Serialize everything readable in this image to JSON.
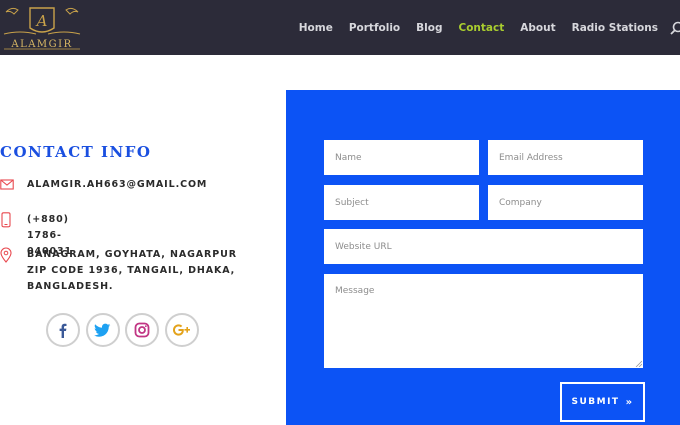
{
  "header": {
    "logo": {
      "monogram": "A",
      "wordmark": "ALAMGIR"
    },
    "nav": [
      {
        "label": "Home",
        "active": false
      },
      {
        "label": "Portfolio",
        "active": false
      },
      {
        "label": "Blog",
        "active": false
      },
      {
        "label": "Contact",
        "active": true
      },
      {
        "label": "About",
        "active": false
      },
      {
        "label": "Radio Stations",
        "active": false
      }
    ],
    "search_icon": "search-icon"
  },
  "contact_info": {
    "title": "CONTACT INFO",
    "email": "ALAMGIR.AH663@GMAIL.COM",
    "phone": "(+880) 1786-040031",
    "address": "BANAGRAM, GOYHATA, NAGARPUR ZIP CODE 1936, TANGAIL, DHAKA, BANGLADESH.",
    "icons": [
      "envelope-icon",
      "mobile-phone-icon",
      "map-pin-icon"
    ],
    "socials": [
      "facebook-icon",
      "twitter-icon",
      "instagram-icon",
      "google-plus-icon"
    ]
  },
  "form": {
    "name_placeholder": "Name",
    "email_placeholder": "Email Address",
    "subject_placeholder": "Subject",
    "company_placeholder": "Company",
    "url_placeholder": "Website URL",
    "message_placeholder": "Message",
    "submit_label": "SUBMIT",
    "submit_icon": "»"
  },
  "colors": {
    "header_bg": "#2c2b39",
    "nav_active": "#a9cd2f",
    "panel_bg": "#0c53f5",
    "title_blue": "#1a4fe0",
    "icon_red": "#e8494f",
    "logo_gold": "#c9a24a"
  }
}
